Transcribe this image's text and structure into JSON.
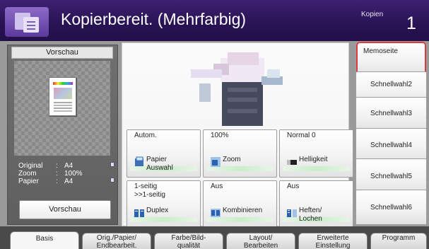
{
  "header": {
    "title": "Kopierbereit. (Mehrfarbig)",
    "copies_label": "Kopien",
    "copies_value": "1"
  },
  "preview": {
    "header": "Vorschau",
    "info": [
      {
        "label": "Original",
        "value": "A4"
      },
      {
        "label": "Zoom",
        "value": "100%"
      },
      {
        "label": "Papier",
        "value": "A4"
      }
    ],
    "separator": ":",
    "button_label": "Vorschau"
  },
  "settings": [
    {
      "value": "Autom.",
      "label": "Papier\nAuswahl",
      "icon": "paper-icon"
    },
    {
      "value": "100%",
      "label": "Zoom",
      "icon": "zoom-icon"
    },
    {
      "value": "Normal 0",
      "label": "Helligkeit",
      "icon": "density-icon"
    },
    {
      "value": "1-seitig\n>>1-seitig",
      "label": "Duplex",
      "icon": "duplex-icon"
    },
    {
      "value": "Aus",
      "label": "Kombinieren",
      "icon": "combine-icon"
    },
    {
      "value": "Aus",
      "label": "Heften/\nLochen",
      "icon": "staple-icon"
    }
  ],
  "quick_buttons": [
    "Memoseite",
    "Schnellwahl2",
    "Schnellwahl3",
    "Schnellwahl4",
    "Schnellwahl5",
    "Schnellwahl6"
  ],
  "tabs": [
    "Basis",
    "Orig./Papier/\nEndbearbeit.",
    "Farbe/Bild-\nqualität",
    "Layout/\nBearbeiten",
    "Erweiterte\nEinstellung",
    "Programm"
  ],
  "colors": {
    "header_bg": "#2a1356",
    "highlight": "#d93c3c",
    "body_bg": "#9a9a9a"
  }
}
